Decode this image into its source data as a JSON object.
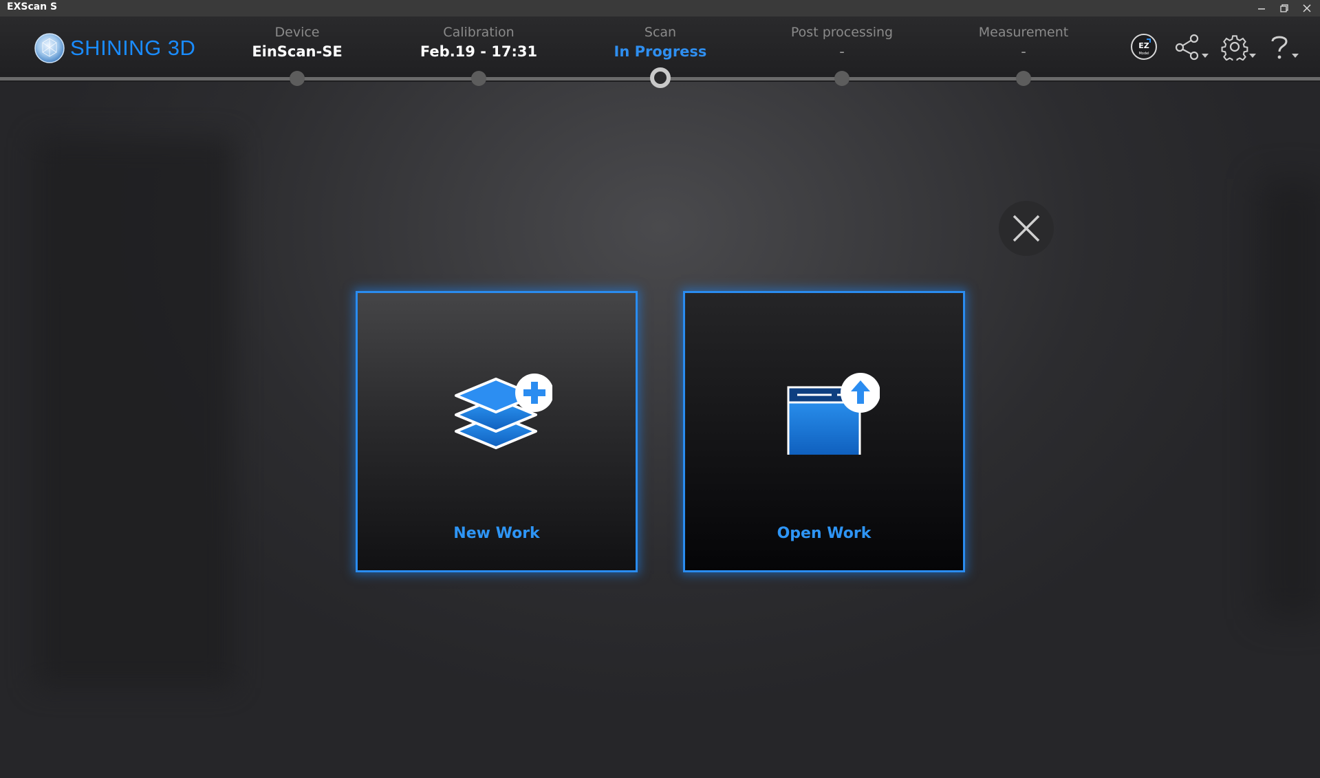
{
  "window": {
    "title": "EXScan S"
  },
  "brand": {
    "name": "SHINING 3D",
    "color": "#1a8cff"
  },
  "steps": [
    {
      "label": "Device",
      "value": "EinScan-SE",
      "state": "done"
    },
    {
      "label": "Calibration",
      "value": "Feb.19 - 17:31",
      "state": "done"
    },
    {
      "label": "Scan",
      "value": "In Progress",
      "state": "current"
    },
    {
      "label": "Post processing",
      "value": "-",
      "state": "pending"
    },
    {
      "label": "Measurement",
      "value": "-",
      "state": "pending"
    }
  ],
  "toolbar": {
    "icons": [
      "ez-model-icon",
      "share-icon",
      "settings-gear-icon",
      "help-question-icon"
    ],
    "ez_text": "Model"
  },
  "dialog": {
    "new_work_label": "New Work",
    "open_work_label": "Open Work"
  },
  "colors": {
    "accent": "#2a8cf0",
    "active_text": "#2f8ff0"
  }
}
